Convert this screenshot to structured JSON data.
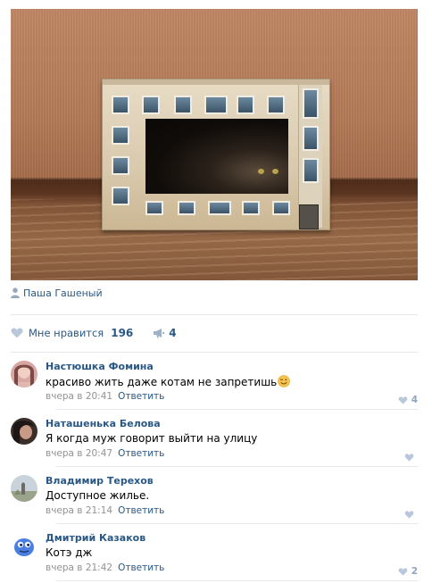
{
  "post": {
    "author": "Паша Гашеный",
    "likes_label": "Мне нравится",
    "likes_count": "196",
    "shares_count": "4"
  },
  "comments": [
    {
      "name": "Настюшка Фомина",
      "text": "красиво жить даже котам не запретишь",
      "time": "вчера в 20:41",
      "reply": "Ответить",
      "likes": "4",
      "emoji": "wink-emoji"
    },
    {
      "name": "Наташенька Белова",
      "text": "Я когда муж говорит выйти на улицу",
      "time": "вчера в 20:47",
      "reply": "Ответить",
      "likes": ""
    },
    {
      "name": "Владимир Терехов",
      "text": "Доступное жилье.",
      "time": "вчера в 21:14",
      "reply": "Ответить",
      "likes": ""
    },
    {
      "name": "Дмитрий Казаков",
      "text": "Котэ дж",
      "time": "вчера в 21:42",
      "reply": "Ответить",
      "likes": "2"
    }
  ],
  "icons": {
    "author": "user-icon",
    "like": "heart-icon",
    "share": "megaphone-icon"
  },
  "colors": {
    "link": "#2a5885",
    "meta": "#939393",
    "heart": "#b8c8da",
    "separator": "#e7e8ec"
  }
}
